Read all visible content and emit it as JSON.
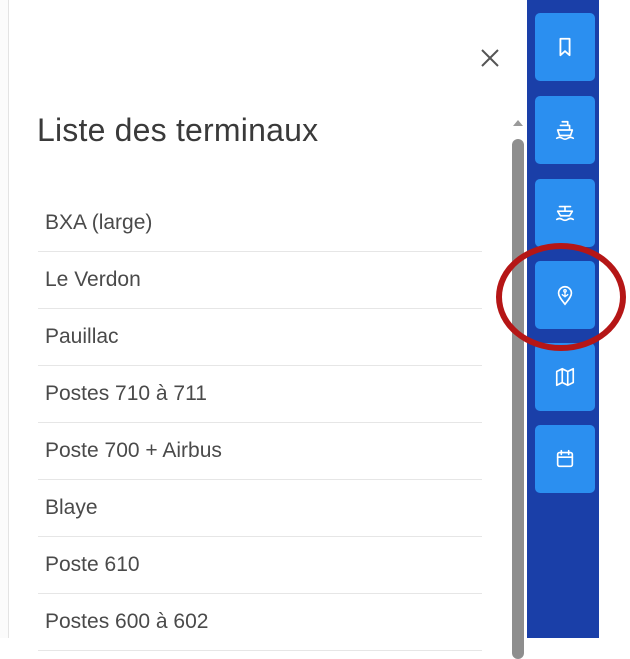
{
  "panel": {
    "title": "Liste des terminaux",
    "items": [
      {
        "label": "BXA (large)"
      },
      {
        "label": "Le Verdon"
      },
      {
        "label": "Pauillac"
      },
      {
        "label": "Postes 710 à 711"
      },
      {
        "label": "Poste 700 + Airbus"
      },
      {
        "label": "Blaye"
      },
      {
        "label": "Poste 610"
      },
      {
        "label": "Postes 600 à 602"
      }
    ]
  },
  "sidebar": {
    "buttons": [
      {
        "icon": "bookmark-icon"
      },
      {
        "icon": "ship-icon"
      },
      {
        "icon": "ship-wave-icon"
      },
      {
        "icon": "anchor-pin-icon",
        "highlighted": true
      },
      {
        "icon": "map-icon"
      },
      {
        "icon": "calendar-icon"
      }
    ]
  },
  "colors": {
    "sidebar_bg": "#1a3fa8",
    "button_bg": "#2b8ff0",
    "highlight_ring": "#b51616"
  }
}
